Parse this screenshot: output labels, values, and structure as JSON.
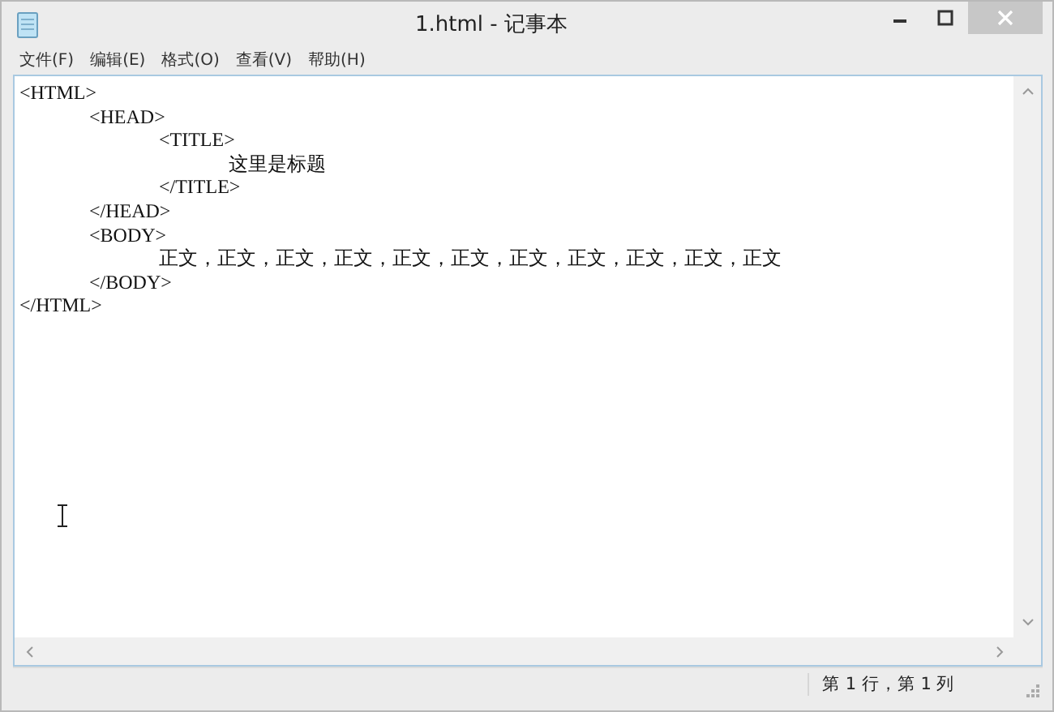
{
  "window": {
    "title": "1.html - 记事本"
  },
  "menu": [
    {
      "label": "文件(F)"
    },
    {
      "label": "编辑(E)"
    },
    {
      "label": "格式(O)"
    },
    {
      "label": "查看(V)"
    },
    {
      "label": "帮助(H)"
    }
  ],
  "document": [
    {
      "text": "<HTML>",
      "children": [
        {
          "text": "<HEAD>",
          "children": [
            {
              "text": "<TITLE>",
              "children": [
                {
                  "text": "这里是标题"
                }
              ]
            },
            {
              "text": "</TITLE>"
            }
          ]
        },
        {
          "text": "</HEAD>"
        },
        {
          "text": "<BODY>",
          "children": [
            {
              "text": "正文，正文，正文，正文，正文，正文，正文，正文，正文，正文，正文"
            }
          ]
        },
        {
          "text": "</BODY>"
        }
      ]
    },
    {
      "text": "</HTML>"
    }
  ],
  "status_bar": {
    "position": "第 1 行，第 1 列"
  }
}
